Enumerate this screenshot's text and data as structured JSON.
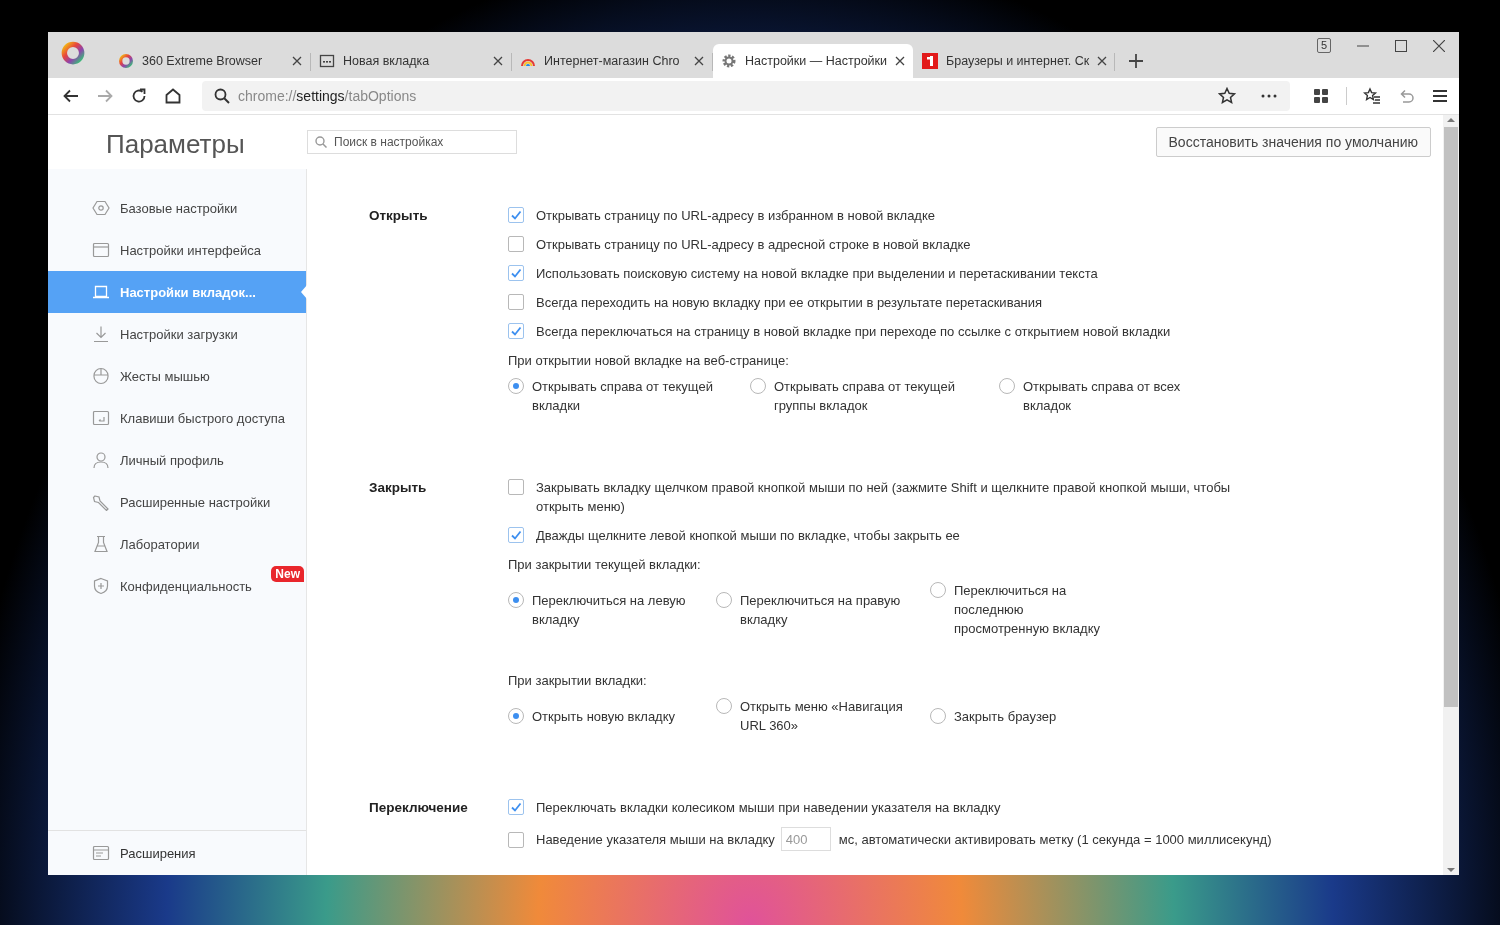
{
  "tabs": [
    {
      "title": "360 Extreme Browser",
      "selected": false
    },
    {
      "title": "Новая вкладка",
      "selected": false
    },
    {
      "title": "Интернет-магазин Chro",
      "selected": false
    },
    {
      "title": "Настройки — Настройки",
      "selected": true
    },
    {
      "title": "Браузеры и интернет. Ск",
      "selected": false
    }
  ],
  "tab_count": "5",
  "address_bar": {
    "prefix": "chrome://",
    "host": "settings",
    "path": "/tabOptions"
  },
  "header": {
    "title": "Параметры",
    "search_placeholder": "Поиск в настройках",
    "reset_button": "Восстановить значения по умолчанию"
  },
  "sidebar": {
    "items": [
      {
        "label": "Базовые настройки",
        "selected": false
      },
      {
        "label": "Настройки интерфейса",
        "selected": false
      },
      {
        "label": "Настройки вкладок...",
        "selected": true
      },
      {
        "label": "Настройки загрузки",
        "selected": false
      },
      {
        "label": "Жесты мышью",
        "selected": false
      },
      {
        "label": "Клавиши быстрого доступа",
        "selected": false
      },
      {
        "label": "Личный профиль",
        "selected": false
      },
      {
        "label": "Расширенные настройки",
        "selected": false
      },
      {
        "label": "Лаборатории",
        "selected": false
      },
      {
        "label": "Конфиденциальность",
        "selected": false,
        "badge": "New"
      }
    ],
    "footer": "Расширения"
  },
  "sections": [
    {
      "title": "Открыть",
      "rows": [
        {
          "kind": "checkbox",
          "label": "Открывать страницу по URL-адресу в избранном в новой вкладке",
          "checked": true
        },
        {
          "kind": "checkbox",
          "label": "Открывать страницу по URL-адресу в адресной строке в новой вкладке",
          "checked": false
        },
        {
          "kind": "checkbox",
          "label": "Использовать поисковую систему на новой вкладке при выделении и перетаскивании текста",
          "checked": true
        },
        {
          "kind": "checkbox",
          "label": "Всегда переходить на новую вкладку при ее открытии в результате перетаскивания",
          "checked": false
        },
        {
          "kind": "checkbox",
          "label": "Всегда переключаться на страницу в новой вкладке при переходе по ссылке с открытием новой вкладки",
          "checked": true
        },
        {
          "kind": "caption",
          "label": "При открытии новой вкладке на веб-странице:"
        },
        {
          "kind": "radios",
          "options": [
            {
              "label": "Открывать справа от текущей вкладки",
              "selected": true
            },
            {
              "label": "Открывать справа от текущей группы вкладок",
              "selected": false
            },
            {
              "label": "Открывать справа от всех вкладок",
              "selected": false
            }
          ]
        }
      ]
    },
    {
      "title": "Закрыть",
      "rows": [
        {
          "kind": "checkbox",
          "label": "Закрывать вкладку щелчком правой кнопкой мыши по ней (зажмите Shift и щелкните правой кнопкой мыши, чтобы открыть меню)",
          "checked": false
        },
        {
          "kind": "checkbox",
          "label": "Дважды щелкните левой кнопкой мыши по вкладке, чтобы закрыть ее",
          "checked": true
        },
        {
          "kind": "caption",
          "label": "При закрытии текущей вкладки:"
        },
        {
          "kind": "radios",
          "options": [
            {
              "label": "Переключиться на левую вкладку",
              "selected": true
            },
            {
              "label": "Переключиться на правую вкладку",
              "selected": false
            },
            {
              "label": "Переключиться на последнюю просмотренную вкладку",
              "selected": false
            }
          ]
        },
        {
          "kind": "caption",
          "label": "При закрытии вкладки:"
        },
        {
          "kind": "radios",
          "options": [
            {
              "label": "Открыть новую вкладку",
              "selected": true
            },
            {
              "label": "Открыть меню «Навигация URL 360»",
              "selected": false
            },
            {
              "label": "Закрыть браузер",
              "selected": false
            }
          ]
        }
      ]
    },
    {
      "title": "Переключение",
      "rows": [
        {
          "kind": "checkbox",
          "label": "Переключать вкладки колесиком мыши при наведении указателя на вкладку",
          "checked": true
        },
        {
          "kind": "checkbox-input",
          "label": "Наведение указателя мыши на вкладку",
          "value": "400",
          "label_after": "мс, автоматически активировать метку (1 секунда = 1000 миллисекунд)",
          "checked": false
        }
      ]
    }
  ]
}
